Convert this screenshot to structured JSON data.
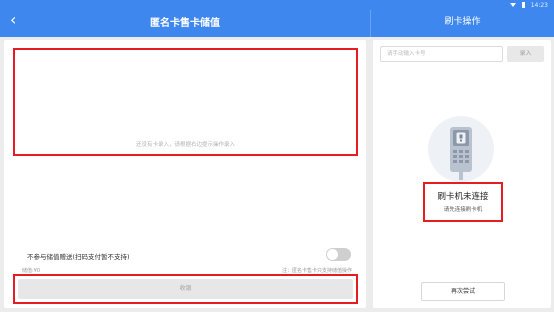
{
  "status_bar": {
    "time": "14:23"
  },
  "header": {
    "title": "匿名卡售卡储值",
    "right_title": "刷卡操作"
  },
  "left": {
    "empty_hint": "还没有卡录入，请根据右边提示操作录入",
    "option_label": "不参与储值赠送(扫码支付暂不支持)",
    "option_enabled": false,
    "total_label": "储值:¥0",
    "note": "注：匿名卡售卡只支持储值操作",
    "pay_button": "收银"
  },
  "right": {
    "input_placeholder": "请手动输入卡号",
    "input_value": "",
    "enter_button": "录入",
    "status_title": "刷卡机未连接",
    "status_subtitle": "请先连接刷卡机",
    "retry_button": "再次尝试"
  },
  "colors": {
    "header": "#3d87ef",
    "highlight": "#e41d23"
  },
  "icons": {
    "back": "back-arrow-icon",
    "wifi": "wifi-icon",
    "battery": "battery-icon",
    "reader": "card-reader-icon"
  }
}
